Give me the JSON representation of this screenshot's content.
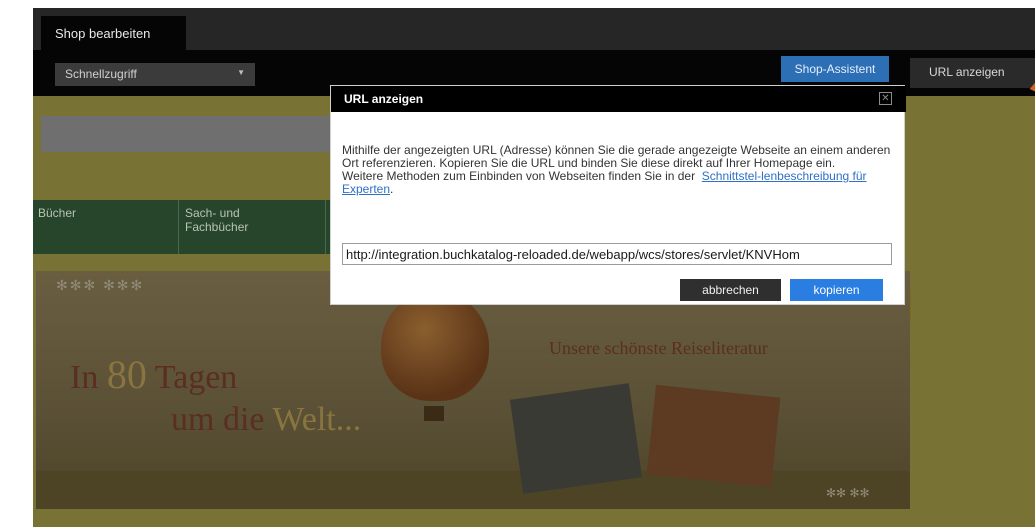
{
  "tabs": {
    "active_label": "Shop bearbeiten"
  },
  "toolbar": {
    "quick_access_label": "Schnellzugriff",
    "shop_assistant_label": "Shop-Assistent",
    "show_url_label": "URL anzeigen"
  },
  "background_page": {
    "nav": [
      {
        "label": "Bücher"
      },
      {
        "label": "Sach- und Fachbücher"
      }
    ],
    "banner": {
      "title_in": "In",
      "title_num": "80",
      "title_days": "Tagen",
      "title_around": "um die",
      "title_world": "Welt...",
      "tagline": "Unsere schönste Reiseliteratur"
    }
  },
  "dialog": {
    "title": "URL anzeigen",
    "paragraph1": "Mithilfe der angezeigten URL (Adresse) können Sie die gerade angezeigte Webseite an einem anderen Ort referenzieren. Kopieren Sie die URL und binden Sie diese direkt auf Ihrer Homepage ein.",
    "paragraph2": "Weitere Methoden zum Einbinden von Webseiten finden Sie in der",
    "link_text": "Schnittstel-lenbeschreibung für Experten",
    "link_suffix": ".",
    "url_value": "http://integration.buchkatalog-reloaded.de/webapp/wcs/stores/servlet/KNVHom",
    "cancel_label": "abbrechen",
    "copy_label": "kopieren"
  },
  "colors": {
    "accent_blue": "#2a7de1",
    "arrow_orange": "#d8611f",
    "dialog_header": "#000000"
  }
}
